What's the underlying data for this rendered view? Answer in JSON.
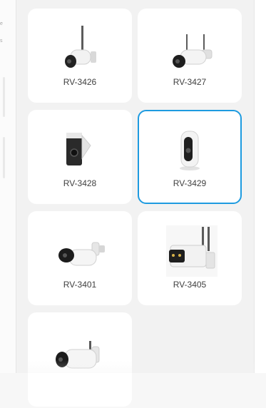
{
  "left_gutter": {
    "fragments": [
      "e",
      "s"
    ]
  },
  "devices": [
    {
      "model": "RV-3426",
      "icon": "bullet-camera-icon",
      "selected": false
    },
    {
      "model": "RV-3427",
      "icon": "bullet-camera-icon",
      "selected": false
    },
    {
      "model": "RV-3428",
      "icon": "battery-camera-icon",
      "selected": false
    },
    {
      "model": "RV-3429",
      "icon": "indoor-camera-icon",
      "selected": true
    },
    {
      "model": "RV-3401",
      "icon": "bullet-camera-icon",
      "selected": false
    },
    {
      "model": "RV-3405",
      "icon": "dual-antenna-camera-icon",
      "selected": false
    },
    {
      "model": "",
      "icon": "bullet-camera-icon",
      "selected": false
    }
  ],
  "colors": {
    "selected_border": "#1e9be0",
    "card_bg": "#ffffff",
    "panel_bg": "#f2f2f2"
  }
}
